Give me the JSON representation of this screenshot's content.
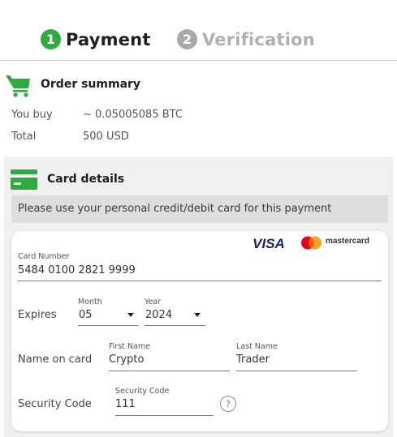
{
  "steps": [
    {
      "number": "1",
      "label": "Payment"
    },
    {
      "number": "2",
      "label": "Verification"
    }
  ],
  "order_summary": {
    "title": "Order summary",
    "rows": [
      {
        "label": "You buy",
        "value": "~ 0.05005085 BTC"
      },
      {
        "label": "Total",
        "value": "500 USD"
      }
    ]
  },
  "card_details": {
    "title": "Card details",
    "notice": "Please use your personal credit/debit card for this payment",
    "brands": {
      "visa": "VISA",
      "mastercard": "mastercard"
    },
    "card_number": {
      "label": "Card Number",
      "value": "5484 0100 2821 9999"
    },
    "expires": {
      "label": "Expires",
      "month": {
        "label": "Month",
        "value": "05"
      },
      "year": {
        "label": "Year",
        "value": "2024"
      }
    },
    "name_on_card": {
      "label": "Name on card",
      "first": {
        "label": "First Name",
        "value": "Crypto"
      },
      "last": {
        "label": "Last Name",
        "value": "Trader"
      }
    },
    "security_code": {
      "label": "Security Code",
      "field_label": "Security Code",
      "value": "111",
      "help": "?"
    }
  },
  "colors": {
    "accent": "#2eaa3f",
    "inactive_step": "#a9a9a9",
    "visa_blue": "#1a1f71",
    "mc_red": "#eb001b",
    "mc_orange": "#f79e1b"
  },
  "icons": {
    "cart": "shopping-cart-icon",
    "card": "credit-card-icon",
    "help": "question-circle-icon",
    "dropdown": "caret-down-icon"
  }
}
